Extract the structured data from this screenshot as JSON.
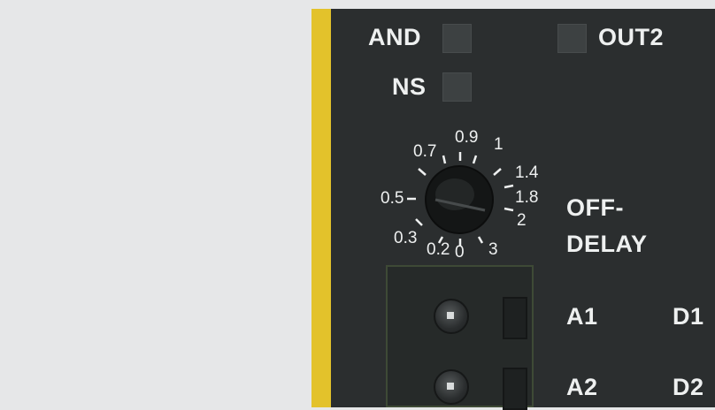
{
  "indicators": {
    "and_label": "AND",
    "out2_label": "OUT2",
    "ns_label": "NS"
  },
  "dial": {
    "scale": [
      "0.7",
      "0.9",
      "1",
      "1.4",
      "0.5",
      "1.8",
      "2",
      "0.3",
      "0.2",
      "0",
      "3"
    ]
  },
  "mode_label_line1": "OFF-",
  "mode_label_line2": "DELAY",
  "terminals": {
    "a1": "A1",
    "d1": "D1",
    "a2": "A2",
    "d2": "D2"
  },
  "colors": {
    "panel": "#2b2e2f",
    "accent_stripe": "#e3c22b",
    "background": "#e6e7e8"
  }
}
